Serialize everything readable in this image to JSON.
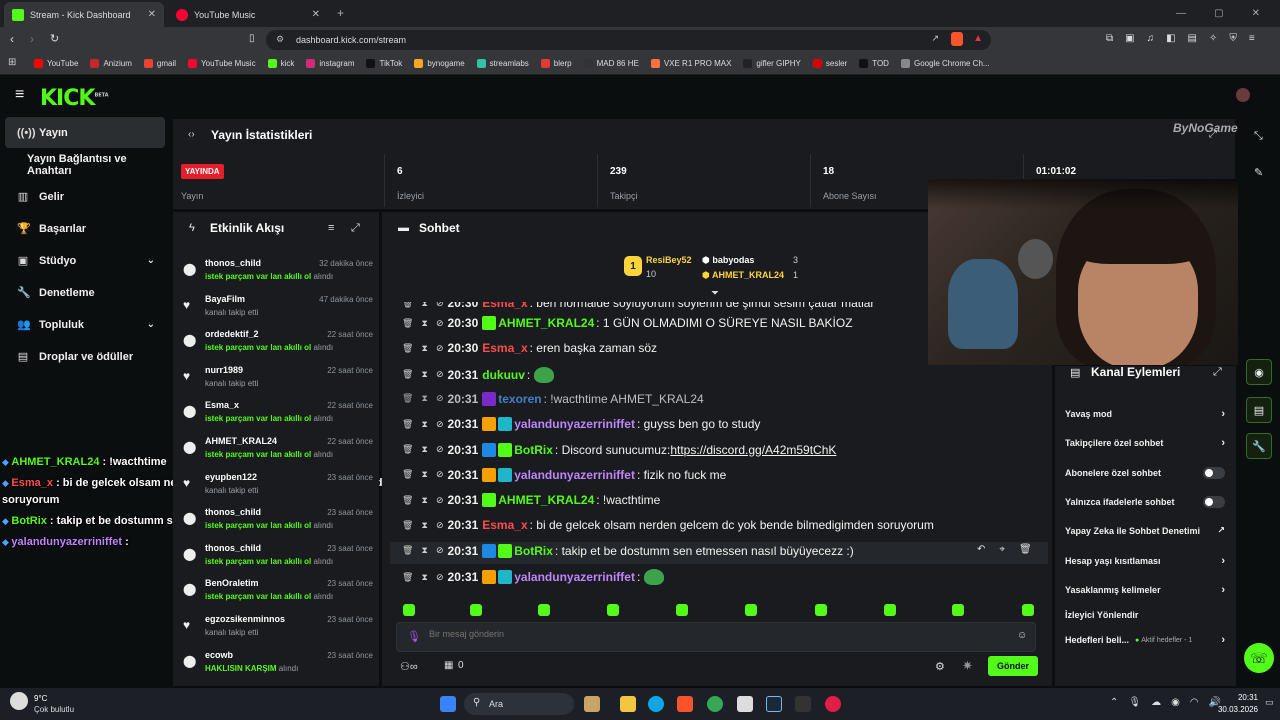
{
  "browser": {
    "tabs": [
      {
        "title": "Stream - Kick Dashboard",
        "active": true,
        "icon_color": "#53fc18"
      },
      {
        "title": "YouTube Music",
        "active": false,
        "icon_color": "#ff0033"
      }
    ],
    "new_tab_label": "+",
    "url": "dashboard.kick.com/stream",
    "bookmarks": [
      {
        "label": "YouTube",
        "color": "#ff0000"
      },
      {
        "label": "Anizium",
        "color": "#c62828"
      },
      {
        "label": "gmail",
        "color": "#ea4335"
      },
      {
        "label": "YouTube Music",
        "color": "#ff0033"
      },
      {
        "label": "kick",
        "color": "#53fc18"
      },
      {
        "label": "instagram",
        "color": "#d62976"
      },
      {
        "label": "TikTok",
        "color": "#111111"
      },
      {
        "label": "bynogame",
        "color": "#f5a623"
      },
      {
        "label": "streamlabs",
        "color": "#31c3a2"
      },
      {
        "label": "blerp",
        "color": "#e53935"
      },
      {
        "label": "MAD 86 HE",
        "color": "#333333"
      },
      {
        "label": "VXE R1 PRO MAX",
        "color": "#ff7043"
      },
      {
        "label": "gifler GIPHY",
        "color": "#222222"
      },
      {
        "label": "sesler",
        "color": "#d50000"
      },
      {
        "label": "TOD",
        "color": "#111111"
      },
      {
        "label": "Google Chrome Ch...",
        "color": "#888888"
      }
    ]
  },
  "header": {
    "logo": "KICK",
    "logo_badge": "BETA"
  },
  "sidebar": {
    "items": [
      {
        "label": "Yayın",
        "icon": "broadcast-icon",
        "glyph": "((•))",
        "active": true
      },
      {
        "label": "Yayın Bağlantısı ve Anahtarı",
        "icon": "",
        "glyph": "",
        "active": false
      },
      {
        "label": "Gelir",
        "icon": "chart-icon",
        "glyph": "▥",
        "active": false
      },
      {
        "label": "Başarılar",
        "icon": "trophy-icon",
        "glyph": "🏆",
        "active": false
      },
      {
        "label": "Stüdyo",
        "icon": "studio-icon",
        "glyph": "▣",
        "active": false,
        "chevron": true
      },
      {
        "label": "Denetleme",
        "icon": "wrench-icon",
        "glyph": "🔧",
        "active": false
      },
      {
        "label": "Topluluk",
        "icon": "community-icon",
        "glyph": "👥",
        "active": false,
        "chevron": true
      },
      {
        "label": "Droplar ve ödüller",
        "icon": "drops-icon",
        "glyph": "▤",
        "active": false
      }
    ]
  },
  "overlay_chat": [
    {
      "user": "AHMET_KRAL24",
      "text": " : !wacthtime",
      "color": "#53fc18"
    },
    {
      "user": "Esma_x",
      "text": " : bi de gelcek olsam nerden gelcem dc yok bende bilmedigimden",
      "color": "#ff4d4d"
    },
    {
      "user": "",
      "text": "soruyorum",
      "color": "#ffffff"
    },
    {
      "user": "BotRix",
      "text": " : takip et be dostumm sen etmessen nasıl büyüyecezz :)",
      "color": "#53fc18"
    },
    {
      "user": "yalandunyazerriniffet",
      "text": " : ",
      "color": "#c084fc"
    }
  ],
  "stats": {
    "title": "Yayın İstatistikleri",
    "live_badge": "YAYINDA",
    "live_label": "Yayın",
    "items": [
      {
        "value": "6",
        "label": "İzleyici"
      },
      {
        "value": "239",
        "label": "Takipçi"
      },
      {
        "value": "18",
        "label": "Abone Sayısı"
      },
      {
        "value": "01:01:02",
        "label": ""
      }
    ]
  },
  "activity": {
    "title": "Etkinlik Akışı",
    "items": [
      {
        "name": "thonos_child",
        "time": "32 dakika önce",
        "desc_em": "istek parçam var lan akıllı ol",
        "desc": " alındı",
        "type": "reward"
      },
      {
        "name": "BayaFilm",
        "time": "47 dakika önce",
        "desc_em": "",
        "desc": "kanalı takip etti",
        "type": "follow"
      },
      {
        "name": "ordedektif_2",
        "time": "22 saat önce",
        "desc_em": "istek parçam var lan akıllı ol",
        "desc": " alındı",
        "type": "reward"
      },
      {
        "name": "nurr1989",
        "time": "22 saat önce",
        "desc_em": "",
        "desc": "kanalı takip etti",
        "type": "follow"
      },
      {
        "name": "Esma_x",
        "time": "22 saat önce",
        "desc_em": "istek parçam var lan akıllı ol",
        "desc": " alındı",
        "type": "reward"
      },
      {
        "name": "AHMET_KRAL24",
        "time": "22 saat önce",
        "desc_em": "istek parçam var lan akıllı ol",
        "desc": " alındı",
        "type": "reward"
      },
      {
        "name": "eyupben122",
        "time": "23 saat önce",
        "desc_em": "",
        "desc": "kanalı takip etti",
        "type": "follow"
      },
      {
        "name": "thonos_child",
        "time": "23 saat önce",
        "desc_em": "istek parçam var lan akıllı ol",
        "desc": " alındı",
        "type": "reward"
      },
      {
        "name": "thonos_child",
        "time": "23 saat önce",
        "desc_em": "istek parçam var lan akıllı ol",
        "desc": " alındı",
        "type": "reward"
      },
      {
        "name": "BenOraletim",
        "time": "23 saat önce",
        "desc_em": "istek parçam var lan akıllı ol",
        "desc": " alındı",
        "type": "reward"
      },
      {
        "name": "egzozsikenminnos",
        "time": "23 saat önce",
        "desc_em": "",
        "desc": "kanalı takip etti",
        "type": "follow"
      },
      {
        "name": "ecowb",
        "time": "23 saat önce",
        "desc_em": "HAKLISIN KARŞIM",
        "desc": " alındı",
        "type": "reward"
      }
    ]
  },
  "chat": {
    "title": "Sohbet",
    "leaders": [
      {
        "name": "ResiBey52",
        "count": "10",
        "color": "#ffd43b"
      },
      {
        "name": "babyodas",
        "count": "3",
        "color": "#ffffff"
      },
      {
        "name": "AHMET_KRAL24",
        "count": "1",
        "color": "#ffd43b"
      }
    ],
    "messages": [
      {
        "time": "20:30",
        "user": "Esma_x",
        "color": "#ff4d4d",
        "badges": [],
        "text": ": ben normalde söylüyorum söylerim de şimdi sesim çatlar matlar",
        "emote": false,
        "partial": true
      },
      {
        "time": "20:30",
        "user": "AHMET_KRAL24",
        "color": "#53fc18",
        "badges": [
          "#53fc18"
        ],
        "text": ": 1 GÜN OLMADIMI O SÜREYE NASIL BAKİOZ",
        "emote": false
      },
      {
        "time": "20:30",
        "user": "Esma_x",
        "color": "#ff4d4d",
        "badges": [],
        "text": ": eren başka zaman söz",
        "emote": false
      },
      {
        "time": "20:31",
        "user": "dukuuv",
        "color": "#53fc18",
        "badges": [],
        "text": ":",
        "emote": true
      },
      {
        "time": "20:31",
        "user": "texoren",
        "color": "#4da3ff",
        "badges": [
          "#9b30ff"
        ],
        "text": ": !wacthtime AHMET_KRAL24",
        "emote": false,
        "dim": true
      },
      {
        "time": "20:31",
        "user": "yalandunyazerriniffet",
        "color": "#c084fc",
        "badges": [
          "#f59f00",
          "#1fb6c9"
        ],
        "text": ": guyss ben go to study",
        "emote": false
      },
      {
        "time": "20:31",
        "user": "BotRix",
        "color": "#53fc18",
        "badges": [
          "#1e88e5",
          "#53fc18"
        ],
        "text": ": Discord sunucumuz: ",
        "link": "https://discord.gg/A42m59tChK",
        "emote": false
      },
      {
        "time": "20:31",
        "user": "yalandunyazerriniffet",
        "color": "#c084fc",
        "badges": [
          "#f59f00",
          "#1fb6c9"
        ],
        "text": ": fizik no fuck me",
        "emote": false
      },
      {
        "time": "20:31",
        "user": "AHMET_KRAL24",
        "color": "#53fc18",
        "badges": [
          "#53fc18"
        ],
        "text": ": !wacthtime",
        "emote": false
      },
      {
        "time": "20:31",
        "user": "Esma_x",
        "color": "#ff4d4d",
        "badges": [],
        "text": ": bi de gelcek olsam nerden gelcem dc yok bende bilmedigimden soruyorum",
        "emote": false
      },
      {
        "time": "20:31",
        "user": "BotRix",
        "color": "#53fc18",
        "badges": [
          "#1e88e5",
          "#53fc18"
        ],
        "text": ": takip et be dostumm sen etmessen nasıl büyüyecezz :)",
        "emote": false
      },
      {
        "time": "20:31",
        "user": "yalandunyazerriniffet",
        "color": "#c084fc",
        "badges": [
          "#f59f00",
          "#1fb6c9"
        ],
        "text": ":",
        "emote": true
      }
    ],
    "input_placeholder": "Bir mesaj gönderin",
    "send_label": "Gönder",
    "points": "0"
  },
  "channel_actions": {
    "title": "Kanal Eylemleri",
    "items": [
      {
        "label": "Yavaş mod",
        "control": "chevron"
      },
      {
        "label": "Takipçilere özel sohbet",
        "control": "chevron"
      },
      {
        "label": "Abonelere özel sohbet",
        "control": "toggle"
      },
      {
        "label": "Yalnızca ifadelerle sohbet",
        "control": "toggle"
      },
      {
        "label": "Yapay Zeka ile Sohbet Denetimi",
        "control": "external"
      },
      {
        "label": "Hesap yaşı kısıtlaması",
        "control": "chevron"
      },
      {
        "label": "Yasaklanmış kelimeler",
        "control": "chevron"
      },
      {
        "label": "İzleyici Yönlendir",
        "control": "none"
      },
      {
        "label": "Hedefleri beli...",
        "control": "chevron",
        "extra": "Aktif hedefler - 1"
      }
    ]
  },
  "taskbar": {
    "weather_temp": "9°C",
    "weather_desc": "Çok bulutlu",
    "search_label": "Ara",
    "time": "20:31",
    "date": "30.03.2026"
  }
}
